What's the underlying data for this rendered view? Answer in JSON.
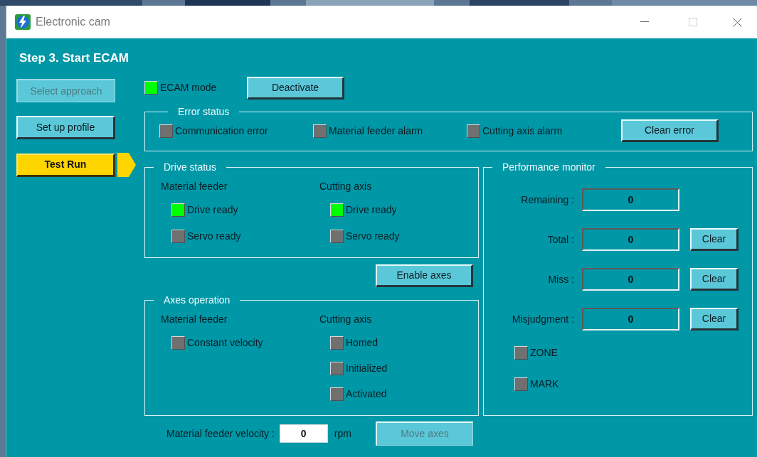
{
  "window": {
    "title": "Electronic cam"
  },
  "step_title": "Step 3. Start ECAM",
  "steps": [
    {
      "label": "Select approach",
      "disabled": true,
      "selected": false
    },
    {
      "label": "Set up profile",
      "disabled": false,
      "selected": false
    },
    {
      "label": "Test Run",
      "disabled": false,
      "selected": true
    }
  ],
  "ecam_mode": {
    "label": "ECAM mode",
    "on": true
  },
  "deactivate_button": "Deactivate",
  "error_status": {
    "title": "Error status",
    "indicators": [
      {
        "label": "Communication error",
        "on": false
      },
      {
        "label": "Material feeder alarm",
        "on": false
      },
      {
        "label": "Cutting axis alarm",
        "on": false
      }
    ],
    "button": "Clean error"
  },
  "drive_status": {
    "title": "Drive status",
    "groups": [
      {
        "heading": "Material feeder",
        "indicators": [
          {
            "label": "Drive ready",
            "on": true
          },
          {
            "label": "Servo ready",
            "on": false
          }
        ]
      },
      {
        "heading": "Cutting axis",
        "indicators": [
          {
            "label": "Drive ready",
            "on": true
          },
          {
            "label": "Servo ready",
            "on": false
          }
        ]
      }
    ]
  },
  "enable_button": "Enable axes",
  "axes_operation": {
    "title": "Axes operation",
    "groups": [
      {
        "heading": "Material feeder",
        "indicators": [
          {
            "label": "Constant velocity",
            "on": false
          }
        ]
      },
      {
        "heading": "Cutting axis",
        "indicators": [
          {
            "label": "Homed",
            "on": false
          },
          {
            "label": "Initialized",
            "on": false
          },
          {
            "label": "Activated",
            "on": false
          }
        ]
      }
    ]
  },
  "velocity": {
    "label": "Material feeder velocity :",
    "value": "0",
    "unit": "rpm"
  },
  "move_button": {
    "label": "Move axes",
    "disabled": true
  },
  "performance_monitor": {
    "title": "Performance monitor",
    "counters": [
      {
        "label": "Remaining :",
        "value": "0"
      },
      {
        "label": "Total :",
        "value": "0",
        "clear_button": "Clear"
      },
      {
        "label": "Miss :",
        "value": "0",
        "clear_button": "Clear"
      },
      {
        "label": "Misjudgment :",
        "value": "0",
        "clear_button": "Clear"
      }
    ],
    "indicators": [
      {
        "label": "ZONE",
        "on": false
      },
      {
        "label": "MARK",
        "on": false
      }
    ]
  }
}
